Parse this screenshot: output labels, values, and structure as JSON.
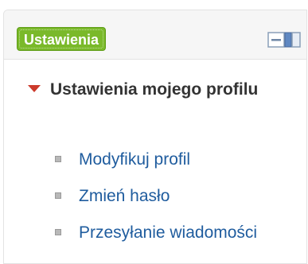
{
  "block": {
    "title": "Ustawienia",
    "dock_icon": "dock-block-icon"
  },
  "tree": {
    "root_label": "Ustawienia mojego profilu",
    "root_icon": "triangle-down-icon",
    "items": [
      {
        "label": "Modyfikuj profil",
        "icon": "bullet-square-icon"
      },
      {
        "label": "Zmień hasło",
        "icon": "bullet-square-icon"
      },
      {
        "label": "Przesyłanie wiadomości",
        "icon": "bullet-square-icon"
      }
    ]
  },
  "colors": {
    "title_bg": "#7ab92a",
    "link": "#1f5c9e",
    "arrow": "#cc3a2b"
  }
}
